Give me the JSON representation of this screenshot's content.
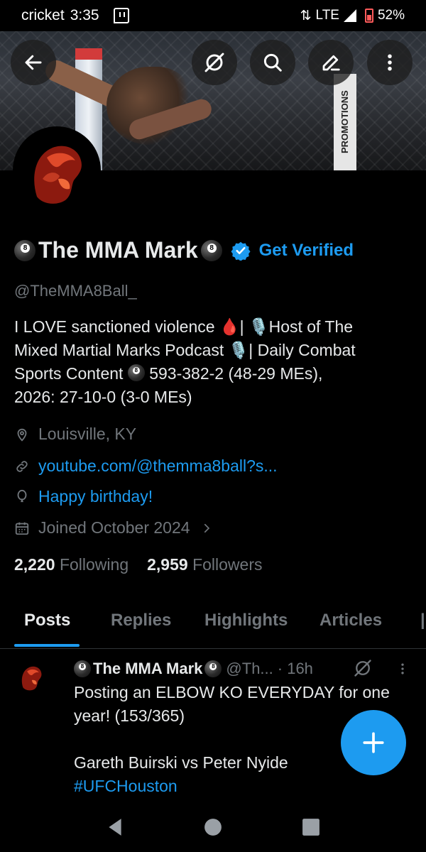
{
  "status_bar": {
    "carrier": "cricket",
    "time": "3:35",
    "network": "LTE",
    "battery": "52%"
  },
  "header": {
    "back_icon": "arrow-left-icon",
    "actions": [
      "grok-icon",
      "search-icon",
      "edit-icon",
      "more-icon"
    ],
    "banner_text": "PROMOTIONS"
  },
  "profile": {
    "name": "The MMA Mark",
    "get_verified": "Get Verified",
    "handle": "@TheMMA8Ball_",
    "bio": {
      "line1": "I LOVE sanctioned violence 🩸| 🎙️Host of The",
      "line2": "Mixed Martial Marks Podcast 🎙️| Daily Combat",
      "line3_a": "Sports Content",
      "line3_b": " 593-382-2 (48-29 MEs),",
      "line4": "2026: 27-10-0 (3-0 MEs)"
    },
    "location": "Louisville, KY",
    "link": "youtube.com/@themma8ball?s...",
    "birthday": "Happy birthday!",
    "joined": "Joined October 2024",
    "following_count": "2,220",
    "following_label": "Following",
    "followers_count": "2,959",
    "followers_label": "Followers"
  },
  "tabs": [
    {
      "label": "Posts",
      "active": true
    },
    {
      "label": "Replies"
    },
    {
      "label": "Highlights"
    },
    {
      "label": "Articles"
    }
  ],
  "tweet": {
    "name": "The MMA Mark",
    "handle": "@Th...",
    "time": "· 16h",
    "line1": "Posting an ELBOW KO EVERYDAY for one",
    "line2": "year! (153/365)",
    "line3": "Gareth Buirski vs Peter Nyide",
    "hashtag": "#UFCHouston"
  },
  "colors": {
    "accent": "#1d9bf0",
    "background": "#000000",
    "text": "#e7e9ea",
    "muted": "#71767b"
  }
}
